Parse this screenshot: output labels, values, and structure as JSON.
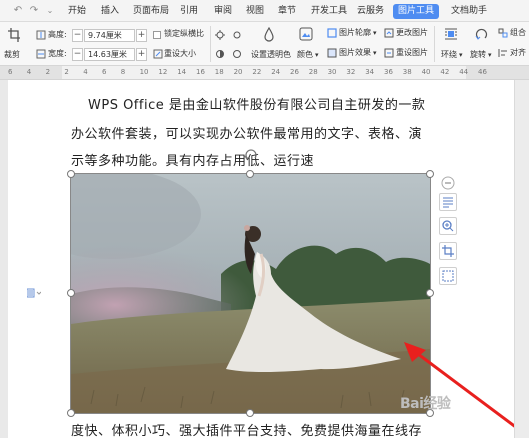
{
  "tabs": {
    "start": "开始",
    "insert": "插入",
    "page_layout": "页面布局",
    "references": "引用",
    "review": "审阅",
    "view": "视图",
    "section": "章节",
    "developer": "开发工具",
    "cloud": "云服务",
    "picture_tools": "图片工具",
    "docer": "文档助手"
  },
  "ribbon": {
    "crop_label": "裁剪",
    "height_label": "高度:",
    "height_value": "9.74厘米",
    "width_label": "宽度:",
    "width_value": "14.63厘米",
    "lock_ratio": "锁定纵横比",
    "reset_size": "重设大小",
    "set_transparent": "设置透明色",
    "color": "颜色",
    "picture_outline": "图片轮廓",
    "picture_effects": "图片效果",
    "change_picture": "更改图片",
    "reset_picture": "重设图片",
    "wrap": "环绕",
    "rotate": "旋转",
    "group": "组合",
    "align": "对齐"
  },
  "ruler": {
    "marks": [
      "6",
      "4",
      "2",
      "2",
      "4",
      "6",
      "8",
      "10",
      "12",
      "14",
      "16",
      "18",
      "20",
      "22",
      "24",
      "26",
      "28",
      "30",
      "32",
      "34",
      "36",
      "38",
      "40",
      "42",
      "44",
      "46"
    ]
  },
  "document": {
    "line1": "WPS Office 是由金山软件股份有限公司自主研发的一款",
    "line2": "办公软件套装，可以实现办公软件最常用的文字、表格、演",
    "line3": "示等多种功能。具有内存占用低、运行速",
    "line4": "度快、体积小巧、强大插件平台支持、免费提供海量在线存"
  },
  "colors": {
    "accent": "#4e8cf1",
    "arrow": "#e8201e"
  },
  "watermark": "Bai经验"
}
